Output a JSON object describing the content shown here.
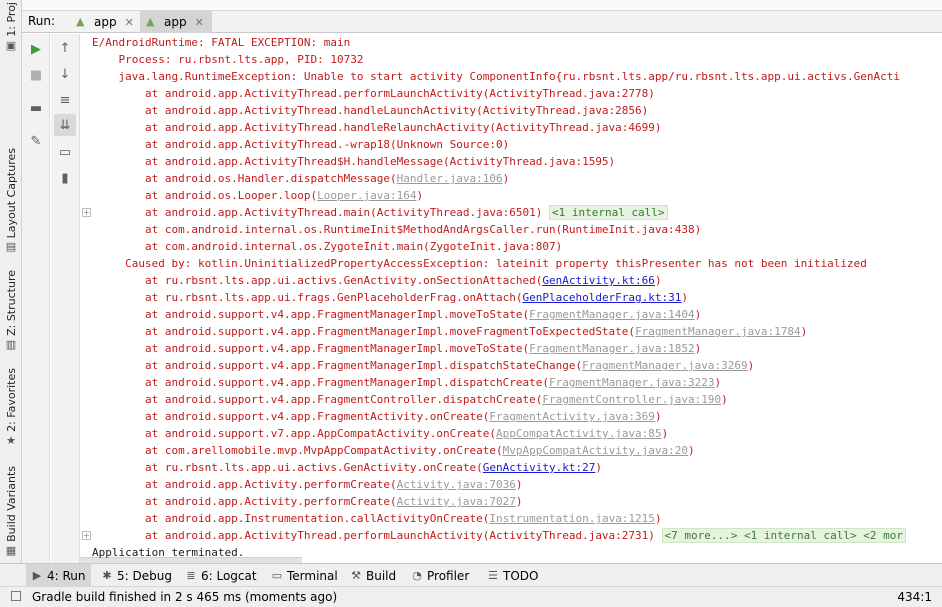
{
  "left_strip": {
    "tabs": [
      {
        "label": "1: Proj",
        "icon": "folder-icon"
      },
      {
        "label": "Layout Captures",
        "icon": "layout-capture-icon"
      },
      {
        "label": "Z: Structure",
        "icon": "structure-icon"
      },
      {
        "label": "2: Favorites",
        "icon": "star-icon"
      },
      {
        "label": "Build Variants",
        "icon": "build-variants-icon"
      }
    ]
  },
  "run": {
    "label": "Run:",
    "tabs": [
      {
        "label": "app",
        "icon": "android-icon"
      },
      {
        "label": "app",
        "icon": "android-icon"
      }
    ]
  },
  "toolbar": {
    "left": [
      "run-icon",
      "stop-icon",
      "layout-icon",
      "pin-icon"
    ],
    "right": [
      "up-arrow-icon",
      "down-arrow-icon",
      "soft-wrap-icon",
      "scroll-to-end-icon",
      "print-icon",
      "trash-icon"
    ]
  },
  "console": {
    "lines": [
      {
        "parts": [
          {
            "t": "E/AndroidRuntime: FATAL EXCEPTION: main",
            "c": "err"
          }
        ]
      },
      {
        "parts": [
          {
            "t": "    Process: ru.rbsnt.lts.app, PID: 10732",
            "c": "err"
          }
        ]
      },
      {
        "parts": [
          {
            "t": "    java.lang.RuntimeException: Unable to start activity ComponentInfo{ru.rbsnt.lts.app/ru.rbsnt.lts.app.ui.activs.GenActi",
            "c": "err"
          }
        ]
      },
      {
        "parts": [
          {
            "t": "        at android.app.ActivityThread.performLaunchActivity(ActivityThread.java:2778)",
            "c": "err"
          }
        ]
      },
      {
        "parts": [
          {
            "t": "        at android.app.ActivityThread.handleLaunchActivity(ActivityThread.java:2856)",
            "c": "err"
          }
        ]
      },
      {
        "parts": [
          {
            "t": "        at android.app.ActivityThread.handleRelaunchActivity(ActivityThread.java:4699)",
            "c": "err"
          }
        ]
      },
      {
        "parts": [
          {
            "t": "        at android.app.ActivityThread.-wrap18(Unknown Source:0)",
            "c": "err"
          }
        ]
      },
      {
        "parts": [
          {
            "t": "        at android.app.ActivityThread$H.handleMessage(ActivityThread.java:1595)",
            "c": "err"
          }
        ]
      },
      {
        "parts": [
          {
            "t": "        at android.os.Handler.dispatchMessage(",
            "c": "err"
          },
          {
            "t": "Handler.java:106",
            "c": "link-gray"
          },
          {
            "t": ")",
            "c": "err"
          }
        ]
      },
      {
        "parts": [
          {
            "t": "        at android.os.Looper.loop(",
            "c": "err"
          },
          {
            "t": "Looper.java:164",
            "c": "link-gray"
          },
          {
            "t": ")",
            "c": "err"
          }
        ]
      },
      {
        "parts": [
          {
            "t": "        at android.app.ActivityThread.main(ActivityThread.java:6501) ",
            "c": "err"
          },
          {
            "t": "<1 internal call>",
            "c": "fold"
          }
        ],
        "fold": true
      },
      {
        "parts": [
          {
            "t": "        at com.android.internal.os.RuntimeInit$MethodAndArgsCaller.run(RuntimeInit.java:438)",
            "c": "err"
          }
        ]
      },
      {
        "parts": [
          {
            "t": "        at com.android.internal.os.ZygoteInit.main(ZygoteInit.java:807)",
            "c": "err"
          }
        ]
      },
      {
        "parts": [
          {
            "t": "     Caused by: kotlin.UninitializedPropertyAccessException: lateinit property thisPresenter has not been initialized",
            "c": "err"
          }
        ]
      },
      {
        "parts": [
          {
            "t": "        at ru.rbsnt.lts.app.ui.activs.GenActivity.onSectionAttached(",
            "c": "err"
          },
          {
            "t": "GenActivity.kt:66",
            "c": "link-blue"
          },
          {
            "t": ")",
            "c": "err"
          }
        ]
      },
      {
        "parts": [
          {
            "t": "        at ru.rbsnt.lts.app.ui.frags.GenPlaceholderFrag.onAttach(",
            "c": "err"
          },
          {
            "t": "GenPlaceholderFrag.kt:31",
            "c": "link-blue"
          },
          {
            "t": ")",
            "c": "err"
          }
        ]
      },
      {
        "parts": [
          {
            "t": "        at android.support.v4.app.FragmentManagerImpl.moveToState(",
            "c": "err"
          },
          {
            "t": "FragmentManager.java:1404",
            "c": "link-gray"
          },
          {
            "t": ")",
            "c": "err"
          }
        ]
      },
      {
        "parts": [
          {
            "t": "        at android.support.v4.app.FragmentManagerImpl.moveFragmentToExpectedState(",
            "c": "err"
          },
          {
            "t": "FragmentManager.java:1784",
            "c": "link-gray"
          },
          {
            "t": ")",
            "c": "err"
          }
        ]
      },
      {
        "parts": [
          {
            "t": "        at android.support.v4.app.FragmentManagerImpl.moveToState(",
            "c": "err"
          },
          {
            "t": "FragmentManager.java:1852",
            "c": "link-gray"
          },
          {
            "t": ")",
            "c": "err"
          }
        ]
      },
      {
        "parts": [
          {
            "t": "        at android.support.v4.app.FragmentManagerImpl.dispatchStateChange(",
            "c": "err"
          },
          {
            "t": "FragmentManager.java:3269",
            "c": "link-gray"
          },
          {
            "t": ")",
            "c": "err"
          }
        ]
      },
      {
        "parts": [
          {
            "t": "        at android.support.v4.app.FragmentManagerImpl.dispatchCreate(",
            "c": "err"
          },
          {
            "t": "FragmentManager.java:3223",
            "c": "link-gray"
          },
          {
            "t": ")",
            "c": "err"
          }
        ]
      },
      {
        "parts": [
          {
            "t": "        at android.support.v4.app.FragmentController.dispatchCreate(",
            "c": "err"
          },
          {
            "t": "FragmentController.java:190",
            "c": "link-gray"
          },
          {
            "t": ")",
            "c": "err"
          }
        ]
      },
      {
        "parts": [
          {
            "t": "        at android.support.v4.app.FragmentActivity.onCreate(",
            "c": "err"
          },
          {
            "t": "FragmentActivity.java:369",
            "c": "link-gray"
          },
          {
            "t": ")",
            "c": "err"
          }
        ]
      },
      {
        "parts": [
          {
            "t": "        at android.support.v7.app.AppCompatActivity.onCreate(",
            "c": "err"
          },
          {
            "t": "AppCompatActivity.java:85",
            "c": "link-gray"
          },
          {
            "t": ")",
            "c": "err"
          }
        ]
      },
      {
        "parts": [
          {
            "t": "        at com.arellomobile.mvp.MvpAppCompatActivity.onCreate(",
            "c": "err"
          },
          {
            "t": "MvpAppCompatActivity.java:20",
            "c": "link-gray"
          },
          {
            "t": ")",
            "c": "err"
          }
        ]
      },
      {
        "parts": [
          {
            "t": "        at ru.rbsnt.lts.app.ui.activs.GenActivity.onCreate(",
            "c": "err"
          },
          {
            "t": "GenActivity.kt:27",
            "c": "link-blue"
          },
          {
            "t": ")",
            "c": "err"
          }
        ]
      },
      {
        "parts": [
          {
            "t": "        at android.app.Activity.performCreate(",
            "c": "err"
          },
          {
            "t": "Activity.java:7036",
            "c": "link-gray"
          },
          {
            "t": ")",
            "c": "err"
          }
        ]
      },
      {
        "parts": [
          {
            "t": "        at android.app.Activity.performCreate(",
            "c": "err"
          },
          {
            "t": "Activity.java:7027",
            "c": "link-gray"
          },
          {
            "t": ")",
            "c": "err"
          }
        ]
      },
      {
        "parts": [
          {
            "t": "        at android.app.Instrumentation.callActivityOnCreate(",
            "c": "err"
          },
          {
            "t": "Instrumentation.java:1215",
            "c": "link-gray"
          },
          {
            "t": ")",
            "c": "err"
          }
        ]
      },
      {
        "parts": [
          {
            "t": "        at android.app.ActivityThread.performLaunchActivity(ActivityThread.java:2731) ",
            "c": "err"
          },
          {
            "t": "<7 more...> <1 internal call> <2 mor",
            "c": "fold"
          }
        ],
        "fold": true
      },
      {
        "parts": [
          {
            "t": "Application terminated.",
            "c": "plain"
          }
        ]
      }
    ]
  },
  "bottom_tabs": [
    {
      "label": "4: Run",
      "icon": "run-icon",
      "selected": true
    },
    {
      "label": "5: Debug",
      "icon": "bug-icon",
      "selected": false
    },
    {
      "label": "6: Logcat",
      "icon": "logcat-icon",
      "selected": false
    },
    {
      "label": "Terminal",
      "icon": "terminal-icon",
      "selected": false
    },
    {
      "label": "Build",
      "icon": "hammer-icon",
      "selected": false
    },
    {
      "label": "Profiler",
      "icon": "profiler-icon",
      "selected": false
    },
    {
      "label": "TODO",
      "icon": "list-icon",
      "selected": false
    }
  ],
  "status_bar": {
    "message": "Gradle build finished in 2 s 465 ms (moments ago)",
    "caret_position": "434:1"
  }
}
